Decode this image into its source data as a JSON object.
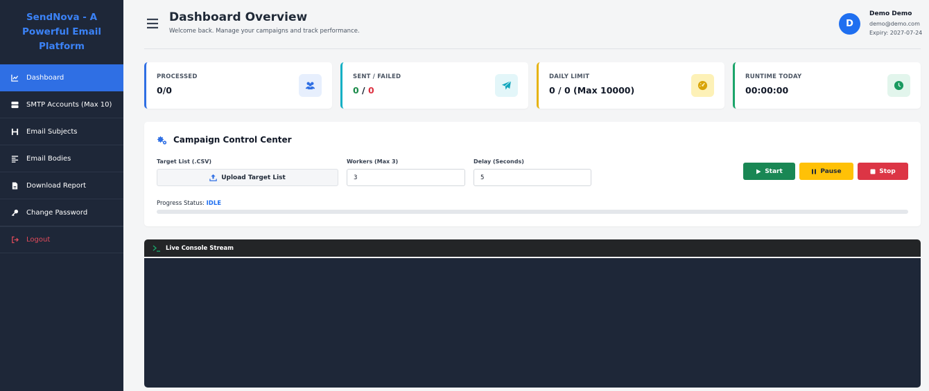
{
  "sidebar": {
    "brand": "SendNova - A Powerful Email Platform",
    "items": [
      {
        "label": "Dashboard",
        "icon": "chart-line-icon",
        "active": true
      },
      {
        "label": "SMTP Accounts (Max 10)",
        "icon": "server-icon"
      },
      {
        "label": "Email Subjects",
        "icon": "heading-icon"
      },
      {
        "label": "Email Bodies",
        "icon": "align-left-icon"
      },
      {
        "label": "Download Report",
        "icon": "file-icon"
      },
      {
        "label": "Change Password",
        "icon": "key-icon"
      },
      {
        "label": "Logout",
        "icon": "sign-out-icon"
      }
    ]
  },
  "header": {
    "title": "Dashboard Overview",
    "subtitle": "Welcome back. Manage your campaigns and track performance.",
    "user": {
      "initial": "D",
      "name": "Demo Demo",
      "email": "demo@demo.com",
      "expiry": "Expiry: 2027-07-24"
    }
  },
  "stats": [
    {
      "label": "PROCESSED",
      "value": "0/0",
      "color": "#2f6fe4",
      "icon": "users-icon"
    },
    {
      "label": "SENT / FAILED",
      "sent": "0",
      "sep": " / ",
      "failed": "0",
      "color": "#13b0c4",
      "icon": "paper-plane-icon"
    },
    {
      "label": "DAILY LIMIT",
      "value": "0 / 0 (Max 10000)",
      "color": "#e6b312",
      "icon": "gauge-icon"
    },
    {
      "label": "RUNTIME TODAY",
      "value": "00:00:00",
      "color": "#1ba56a",
      "icon": "clock-icon"
    }
  ],
  "campaign": {
    "title": "Campaign Control Center",
    "target_label": "Target List (.CSV)",
    "upload_label": "Upload Target List",
    "workers_label": "Workers (Max 3)",
    "workers_value": "3",
    "delay_label": "Delay (Seconds)",
    "delay_value": "5",
    "start_label": "Start",
    "pause_label": "Pause",
    "stop_label": "Stop",
    "progress_label": "Progress Status:",
    "progress_status": "IDLE",
    "progress_fraction": 0
  },
  "console": {
    "title": "Live Console Stream"
  },
  "colors": {
    "primary": "#2f6fe4",
    "start": "#198754",
    "pause": "#ffc107",
    "stop": "#dc3545"
  }
}
